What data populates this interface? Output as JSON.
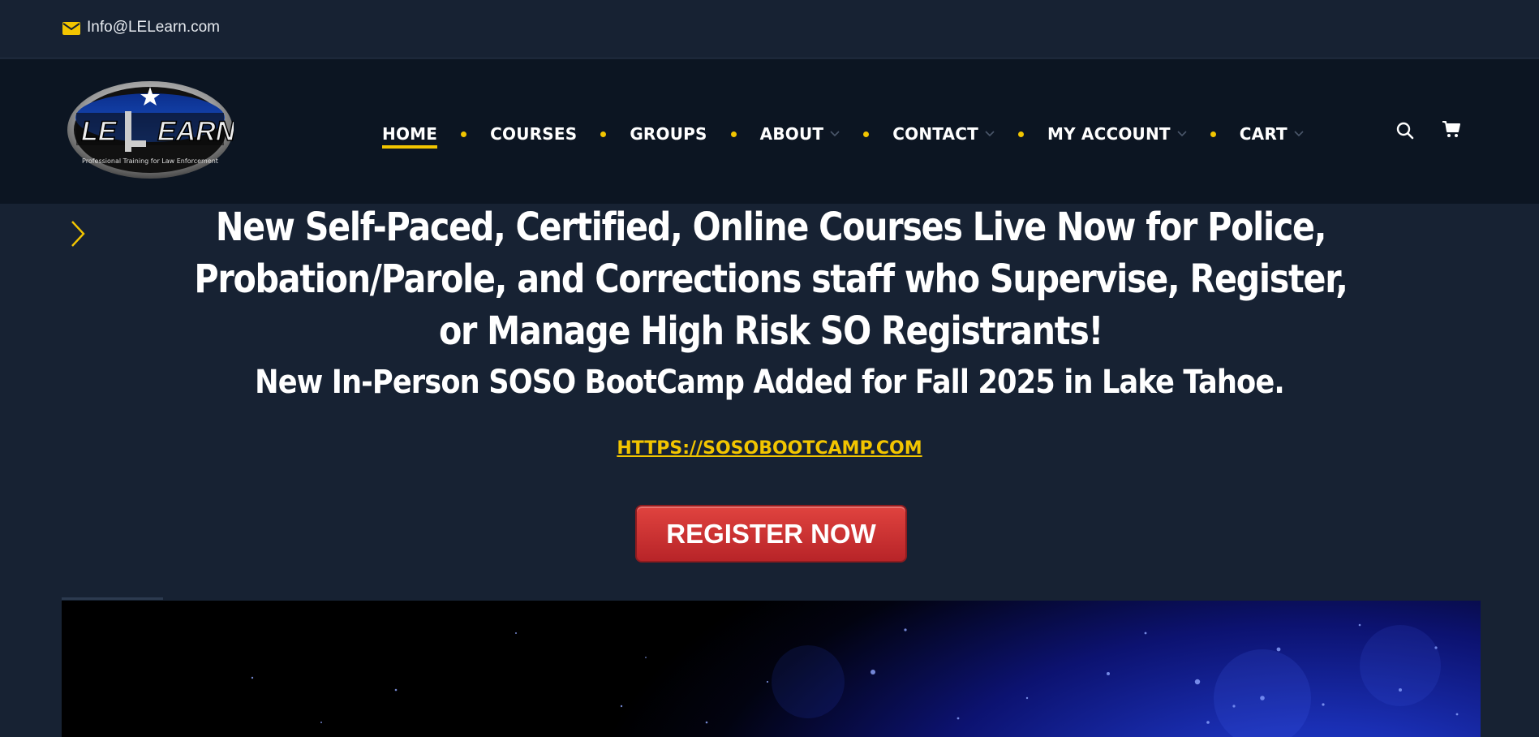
{
  "topbar": {
    "email": "Info@LELearn.com",
    "icon": "mail-icon"
  },
  "header": {
    "logo_text": "LE LEARN",
    "logo_tagline": "Professional Training for Law Enforcement",
    "nav": [
      {
        "label": "HOME",
        "active": true,
        "dropdown": false
      },
      {
        "label": "COURSES",
        "active": false,
        "dropdown": false
      },
      {
        "label": "GROUPS",
        "active": false,
        "dropdown": false
      },
      {
        "label": "ABOUT",
        "active": false,
        "dropdown": true
      },
      {
        "label": "CONTACT",
        "active": false,
        "dropdown": true
      },
      {
        "label": "MY ACCOUNT",
        "active": false,
        "dropdown": true
      },
      {
        "label": "CART",
        "active": false,
        "dropdown": true
      }
    ],
    "icons": [
      "search-icon",
      "cart-icon"
    ]
  },
  "hero": {
    "headline": "New Self-Paced, Certified, Online Courses Live Now for Police, Probation/Parole, and Corrections staff who Supervise, Register, or Manage High Risk SO Registrants!",
    "subhead": "New In-Person SOSO BootCamp Added for Fall 2025 in Lake Tahoe.",
    "link": "HTTPS://SOSOBOOTCAMP.COM",
    "cta": "REGISTER NOW"
  },
  "colors": {
    "accent": "#f2c500",
    "background": "#172233",
    "header": "#0c1522",
    "cta": "#c8302f"
  }
}
